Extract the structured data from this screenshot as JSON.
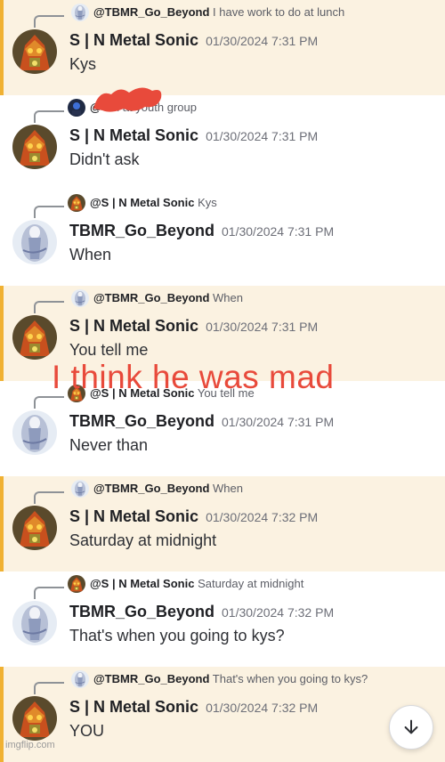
{
  "messages": [
    {
      "highlighted": true,
      "avatar": "metal-sonic",
      "reply_avatar": "beyond",
      "reply_name": "@TBMR_Go_Beyond",
      "reply_text": "I have work to do at lunch",
      "author": "S | N Metal Sonic",
      "timestamp": "01/30/2024 7:31 PM",
      "content": "Kys"
    },
    {
      "highlighted": false,
      "avatar": "metal-sonic",
      "reply_avatar": "other",
      "reply_name": "@",
      "reply_text": "I'm at youth group",
      "author": "S | N Metal Sonic",
      "timestamp": "01/30/2024 7:31 PM",
      "content": "Didn't ask"
    },
    {
      "highlighted": false,
      "avatar": "beyond",
      "reply_avatar": "metal-sonic",
      "reply_name": "@S | N Metal Sonic",
      "reply_text": "Kys",
      "author": "TBMR_Go_Beyond",
      "timestamp": "01/30/2024 7:31 PM",
      "content": "When"
    },
    {
      "highlighted": true,
      "avatar": "metal-sonic",
      "reply_avatar": "beyond",
      "reply_name": "@TBMR_Go_Beyond",
      "reply_text": "When",
      "author": "S | N Metal Sonic",
      "timestamp": "01/30/2024 7:31 PM",
      "content": "You tell me"
    },
    {
      "highlighted": false,
      "avatar": "beyond",
      "reply_avatar": "metal-sonic",
      "reply_name": "@S | N Metal Sonic",
      "reply_text": "You tell me",
      "author": "TBMR_Go_Beyond",
      "timestamp": "01/30/2024 7:31 PM",
      "content": "Never than"
    },
    {
      "highlighted": true,
      "avatar": "metal-sonic",
      "reply_avatar": "beyond",
      "reply_name": "@TBMR_Go_Beyond",
      "reply_text": "When",
      "author": "S | N Metal Sonic",
      "timestamp": "01/30/2024 7:32 PM",
      "content": "Saturday at midnight"
    },
    {
      "highlighted": false,
      "avatar": "beyond",
      "reply_avatar": "metal-sonic",
      "reply_name": "@S | N Metal Sonic",
      "reply_text": "Saturday at midnight",
      "author": "TBMR_Go_Beyond",
      "timestamp": "01/30/2024 7:32 PM",
      "content": "That's when you going to kys?"
    },
    {
      "highlighted": true,
      "avatar": "metal-sonic",
      "reply_avatar": "beyond",
      "reply_name": "@TBMR_Go_Beyond",
      "reply_text": "That's when you going to kys?",
      "author": "S | N Metal Sonic",
      "timestamp": "01/30/2024 7:32 PM",
      "content": "YOU"
    }
  ],
  "overlay_caption": "I think he was mad",
  "watermark": "imgflip.com",
  "scroll_button_icon": "arrow-down-icon",
  "colors": {
    "highlight_bg": "#fbf2e1",
    "highlight_bar": "#f0b132",
    "caption": "#e84a3b",
    "redaction": "#e84a3b"
  }
}
